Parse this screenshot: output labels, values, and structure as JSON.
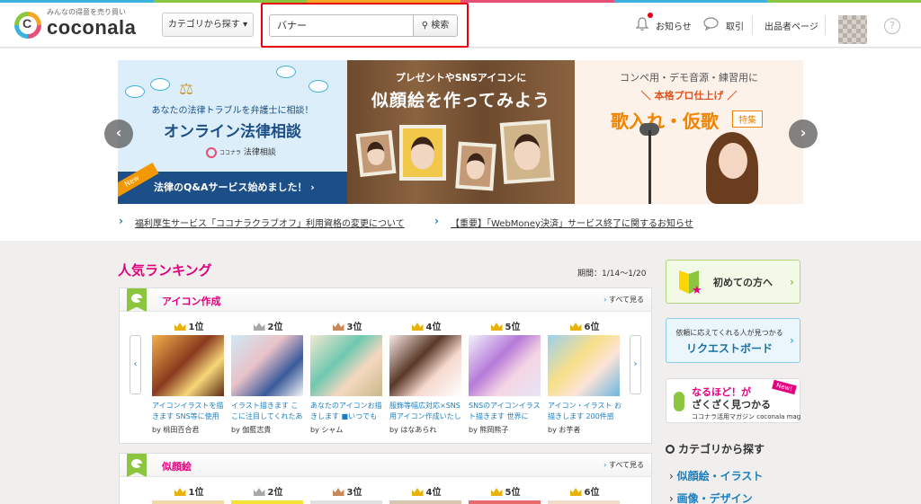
{
  "colors": {
    "accent_pink": "#e3007f",
    "link_blue": "#1a7fc1",
    "highlight_red": "#e60012",
    "brand_green": "#8cc63f",
    "brand_orange": "#f39800",
    "brand_blue": "#3bb3e0",
    "gold": "#e8b30a",
    "silver": "#a8a8a8",
    "bronze": "#c88a5a"
  },
  "header": {
    "logo_tagline": "みんなの得意を売り買い",
    "logo_text": "coconala",
    "logo_mark": "C",
    "category_button": "カテゴリから探す ▾",
    "search_value": "バナー",
    "search_button": "検索",
    "notifications": "お知らせ",
    "transactions": "取引",
    "seller_page": "出品者ページ",
    "help_icon": "?"
  },
  "banners": [
    {
      "subtitle": "あなたの法律トラブルを弁護士に相談！",
      "title": "オンライン法律相談",
      "logo_small": "ココナラ",
      "logo": "法律相談",
      "bottom": "法律のQ&Aサービス始めました！ ›",
      "tag": "New"
    },
    {
      "subtitle": "プレゼントやSNSアイコンに",
      "title": "似顔絵を作ってみよう"
    },
    {
      "subtitle": "コンペ用・デモ音源・練習用に",
      "line": "＼ 本格プロ仕上げ ／",
      "title": "歌入れ・仮歌",
      "badge": "特集"
    }
  ],
  "notices": [
    "福利厚生サービス「ココナラクラブオフ」利用資格の変更について",
    "【重要】「WebMoney決済」サービス終了に関するお知らせ"
  ],
  "ranking": {
    "title": "人気ランキング",
    "period": "期間：1/14〜1/20",
    "see_all": "すべて見る",
    "categories": [
      {
        "name": "アイコン作成",
        "items": [
          {
            "rank": "1位",
            "desc": "アイコンイラストを描きます SNS等に使用",
            "by": "by 桃田百合君"
          },
          {
            "rank": "2位",
            "desc": "イラスト描きます こ こに注目してくれたあ",
            "by": "by 伽藍志貴"
          },
          {
            "rank": "3位",
            "desc": "あなたのアイコンお描 きします ■いつでも",
            "by": "by シャム"
          },
          {
            "rank": "4位",
            "desc": "服飾等幅広対応×SNS用アイコン作成いたし",
            "by": "by はなあられ"
          },
          {
            "rank": "5位",
            "desc": "SNSのアイコンイラスト描きます 世界に",
            "by": "by 熊岡熊子"
          },
          {
            "rank": "6位",
            "desc": "アイコン・イラスト お描きします 200件感",
            "by": "by お芋者"
          }
        ]
      },
      {
        "name": "似顔絵",
        "items": [
          {
            "rank": "1位"
          },
          {
            "rank": "2位"
          },
          {
            "rank": "3位"
          },
          {
            "rank": "4位"
          },
          {
            "rank": "5位"
          },
          {
            "rank": "6位"
          }
        ]
      }
    ]
  },
  "sidebar": {
    "first_time": "初めての方へ",
    "request_small": "依頼に応えてくれる人が見つかる",
    "request_big": "リクエストボード",
    "mag_line1": "なるほど！が",
    "mag_line2": "ざくざく見つかる",
    "mag_line3": "ココナラ活用マガジン coconala mag",
    "mag_new": "New!",
    "category_heading": "カテゴリから探す",
    "category_links": [
      "似顔絵・イラスト",
      "画像・デザイン"
    ]
  },
  "icons": [
    "search-icon",
    "bell-icon",
    "chat-icon",
    "help-icon",
    "crown-icon",
    "chevron-left-icon",
    "chevron-right-icon",
    "beginner-mark-icon",
    "microphone-icon",
    "magnifier-icon"
  ]
}
